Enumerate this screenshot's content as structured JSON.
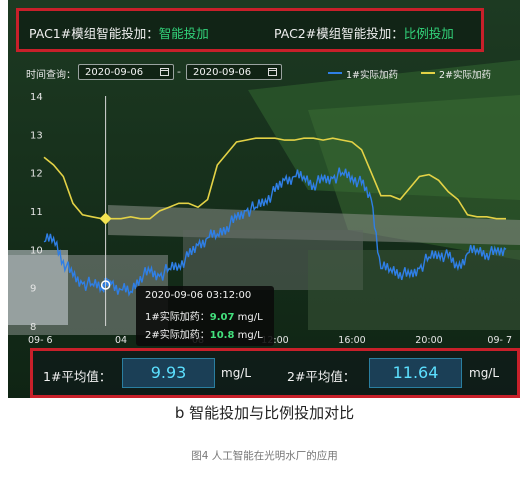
{
  "header": {
    "pac1_label": "PAC1#模组智能投加：",
    "pac1_mode": "智能投加",
    "pac2_label": "PAC2#模组智能投加：",
    "pac2_mode": "比例投加"
  },
  "query": {
    "label": "时间查询：",
    "start_date": "2020-09-06",
    "end_date": "2020-09-06",
    "separator": "-"
  },
  "legend": {
    "series1": "1#实际加药",
    "series2": "2#实际加药"
  },
  "tooltip": {
    "time": "2020-09-06 03:12:00",
    "s1_label": "1#实际加药：",
    "s1_value": "9.07",
    "s1_unit": " mg/L",
    "s2_label": "2#实际加药：",
    "s2_value": "10.8",
    "s2_unit": " mg/L"
  },
  "averages": {
    "a1_label": "1#平均值：",
    "a1_value": "9.93",
    "a1_unit": "mg/L",
    "a2_label": "2#平均值：",
    "a2_value": "11.64",
    "a2_unit": "mg/L"
  },
  "captions": {
    "main": "b 智能投加与比例投加对比",
    "figure": "图4 人工智能在光明水厂的应用"
  },
  "colors": {
    "series1": "#2f7fe6",
    "series2": "#e3d246",
    "highlight": "#c8202a",
    "accent_green": "#32d27a"
  },
  "chart_data": {
    "type": "line",
    "x_ticks": [
      "09- 6",
      "04",
      "08",
      "12:00",
      "16:00",
      "20:00",
      "09- 7"
    ],
    "y_ticks": [
      "8",
      "9",
      "10",
      "11",
      "12",
      "13",
      "14"
    ],
    "ylim": [
      8,
      14
    ],
    "xlim_hours": [
      0,
      24
    ],
    "x_hours": [
      0,
      0.5,
      1,
      1.5,
      2,
      2.5,
      3,
      3.2,
      3.5,
      4,
      4.5,
      5,
      5.5,
      6,
      6.5,
      7,
      7.5,
      8,
      8.5,
      9,
      9.5,
      10,
      10.5,
      11,
      11.5,
      12,
      12.5,
      13,
      13.5,
      14,
      14.5,
      15,
      15.5,
      16,
      16.5,
      17,
      17.5,
      18,
      18.5,
      19,
      19.5,
      20,
      20.5,
      21,
      21.5,
      22,
      22.5,
      23,
      23.5,
      24
    ],
    "series": [
      {
        "name": "1#实际加药",
        "values": [
          10.2,
          10.3,
          9.7,
          9.3,
          9.1,
          9.1,
          9.05,
          9.07,
          9.1,
          8.95,
          8.9,
          9.3,
          9.4,
          9.3,
          9.5,
          9.6,
          9.8,
          10.1,
          10.3,
          10.4,
          10.6,
          10.8,
          11.0,
          11.1,
          11.3,
          11.5,
          11.8,
          11.9,
          11.9,
          11.7,
          11.8,
          11.85,
          12.0,
          11.9,
          11.7,
          11.3,
          9.5,
          9.5,
          9.4,
          9.3,
          9.5,
          9.8,
          9.9,
          9.8,
          9.5,
          9.9,
          10.0,
          9.9,
          9.9,
          10.0
        ]
      },
      {
        "name": "2#实际加药",
        "values": [
          12.4,
          12.2,
          11.9,
          11.2,
          10.9,
          10.85,
          10.8,
          10.8,
          10.8,
          10.8,
          10.85,
          10.8,
          10.8,
          11.0,
          11.1,
          11.2,
          11.2,
          11.1,
          11.3,
          12.2,
          12.5,
          12.8,
          12.85,
          12.9,
          12.9,
          12.9,
          12.85,
          12.85,
          12.9,
          12.9,
          12.85,
          12.9,
          12.85,
          12.8,
          12.6,
          12.0,
          11.4,
          11.4,
          11.3,
          11.6,
          11.9,
          11.95,
          11.8,
          11.5,
          11.3,
          10.9,
          10.85,
          10.85,
          10.8,
          10.8
        ]
      }
    ]
  }
}
